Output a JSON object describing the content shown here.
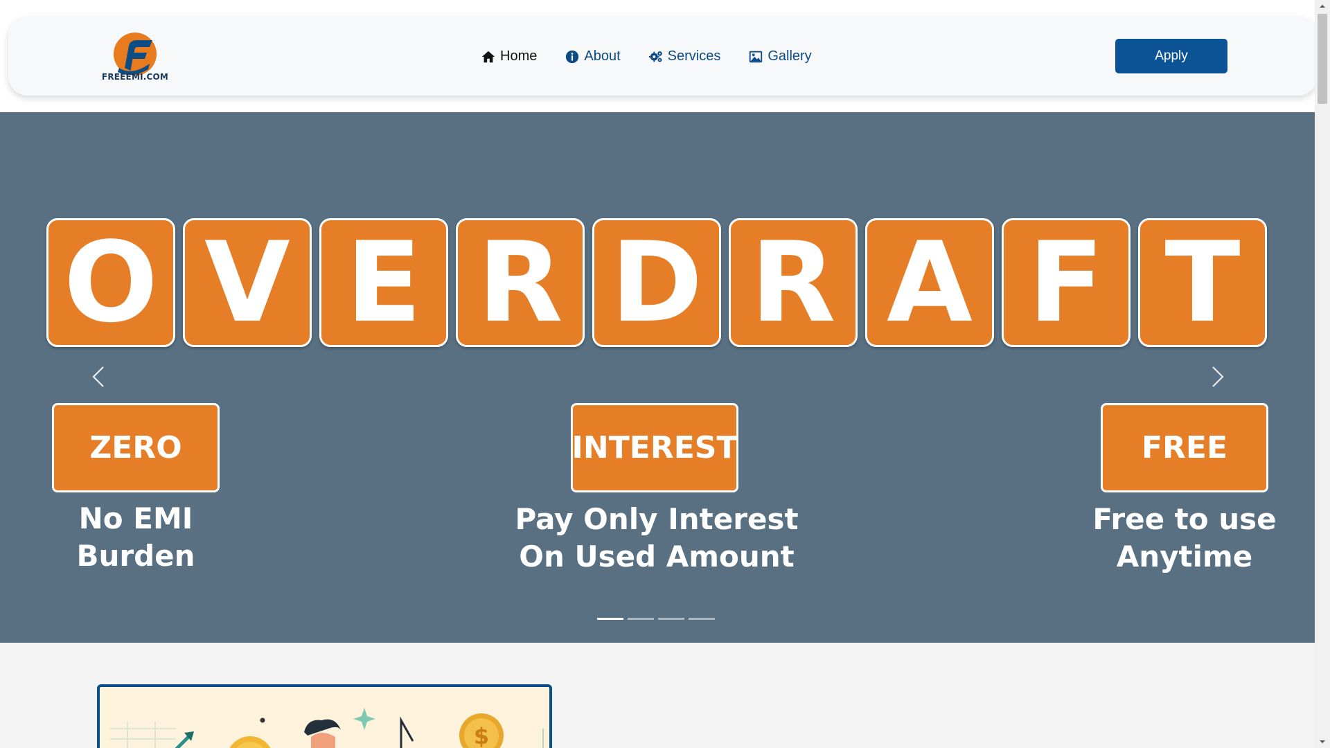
{
  "brand": {
    "logo_text": "FREEEMI.COM"
  },
  "nav": {
    "items": [
      {
        "label": "Home",
        "icon": "home-icon",
        "active": true
      },
      {
        "label": "About",
        "icon": "info-icon",
        "active": false
      },
      {
        "label": "Services",
        "icon": "gears-icon",
        "active": false
      },
      {
        "label": "Gallery",
        "icon": "image-icon",
        "active": false
      }
    ],
    "apply_label": "Apply"
  },
  "hero": {
    "tile_letters": [
      "O",
      "V",
      "E",
      "R",
      "D",
      "R",
      "A",
      "F",
      "T"
    ],
    "features": [
      {
        "badge": "ZERO",
        "caption_line1": "No EMI",
        "caption_line2": "Burden"
      },
      {
        "badge": "INTEREST",
        "caption_line1": "Pay Only Interest",
        "caption_line2": "On Used Amount"
      },
      {
        "badge": "FREE",
        "caption_line1": "Free to use",
        "caption_line2": "Anytime"
      }
    ],
    "slide_count": 4,
    "active_slide": 1
  },
  "colors": {
    "brand_blue": "#0b5394",
    "accent_orange": "#e67e27",
    "hero_bg": "#587082"
  }
}
